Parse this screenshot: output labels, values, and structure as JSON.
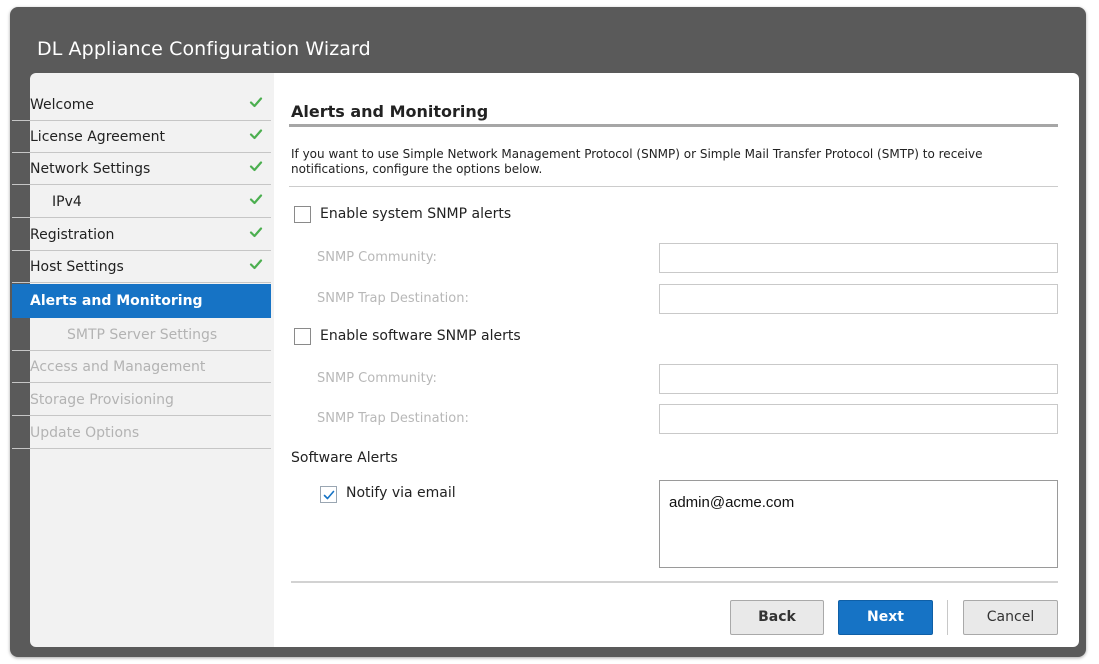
{
  "window": {
    "title": "DL Appliance Configuration Wizard"
  },
  "sidebar": {
    "items": [
      {
        "label": "Welcome",
        "state": "complete"
      },
      {
        "label": "License Agreement",
        "state": "complete"
      },
      {
        "label": "Network Settings",
        "state": "complete"
      },
      {
        "label": "IPv4",
        "state": "complete"
      },
      {
        "label": "Registration",
        "state": "complete"
      },
      {
        "label": "Host Settings",
        "state": "complete"
      },
      {
        "label": "Alerts and Monitoring",
        "state": "active"
      },
      {
        "label": "SMTP Server Settings",
        "state": "disabled"
      },
      {
        "label": "Access and Management",
        "state": "disabled"
      },
      {
        "label": "Storage Provisioning",
        "state": "disabled"
      },
      {
        "label": "Update Options",
        "state": "disabled"
      }
    ]
  },
  "main": {
    "heading": "Alerts and Monitoring",
    "description": "If you want to use Simple Network Management Protocol (SNMP) or Simple Mail Transfer Protocol (SMTP) to receive notifications, configure the options below.",
    "system_snmp": {
      "label": "Enable system SNMP alerts",
      "checked": false,
      "community_label": "SNMP Community:",
      "community_value": "",
      "trap_label": "SNMP Trap Destination:",
      "trap_value": ""
    },
    "software_snmp": {
      "label": "Enable software SNMP alerts",
      "checked": false,
      "community_label": "SNMP Community:",
      "community_value": "",
      "trap_label": "SNMP Trap Destination:",
      "trap_value": ""
    },
    "software_alerts": {
      "heading": "Software Alerts",
      "notify_label": "Notify via email",
      "notify_checked": true,
      "email": "admin@acme.com"
    }
  },
  "buttons": {
    "back": "Back",
    "next": "Next",
    "cancel": "Cancel"
  },
  "colors": {
    "accent": "#1673c5",
    "check": "#4caf50",
    "window_frame": "#5a5a5a"
  }
}
